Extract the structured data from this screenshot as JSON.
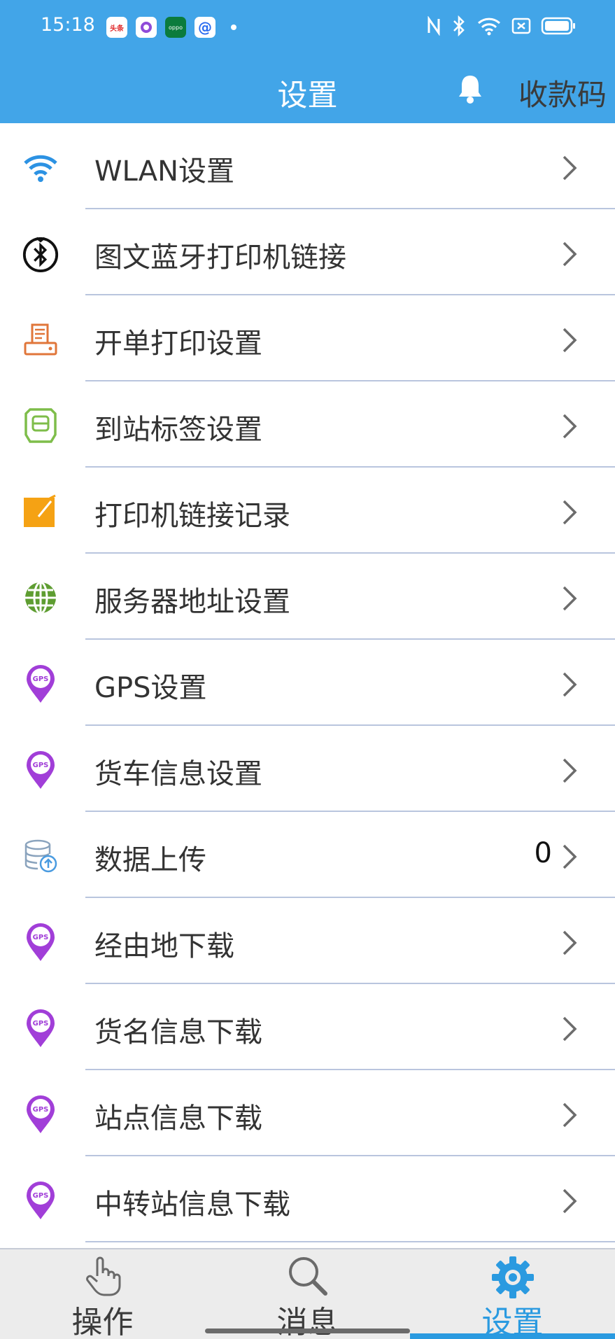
{
  "status_bar": {
    "time": "15:18",
    "notification_icons": [
      "toutiao-app-icon",
      "circle-app-icon",
      "oppo-app-icon",
      "at-app-icon"
    ],
    "toutiao_label": "头条",
    "oppo_label": "oppo",
    "at_label": "@",
    "system_icons": [
      "nfc-icon",
      "bluetooth-icon",
      "wifi-icon",
      "sim-icon",
      "battery-icon"
    ]
  },
  "header": {
    "title": "设置",
    "bell_icon": "bell-icon",
    "pay_code": "收款码",
    "background_color": "#42a5e8"
  },
  "settings": {
    "items": [
      {
        "icon": "wifi-icon",
        "label": "WLAN设置",
        "value": ""
      },
      {
        "icon": "bluetooth-icon",
        "label": "图文蓝牙打印机链接",
        "value": ""
      },
      {
        "icon": "printer-icon",
        "label": "开单打印设置",
        "value": ""
      },
      {
        "icon": "label-icon",
        "label": "到站标签设置",
        "value": ""
      },
      {
        "icon": "note-icon",
        "label": "打印机链接记录",
        "value": ""
      },
      {
        "icon": "globe-icon",
        "label": "服务器地址设置",
        "value": ""
      },
      {
        "icon": "gps-pin-icon",
        "label": "GPS设置",
        "value": ""
      },
      {
        "icon": "gps-pin-icon",
        "label": "货车信息设置",
        "value": ""
      },
      {
        "icon": "database-upload-icon",
        "label": "数据上传",
        "value": "0"
      },
      {
        "icon": "gps-pin-icon",
        "label": "经由地下载",
        "value": ""
      },
      {
        "icon": "gps-pin-icon",
        "label": "货名信息下载",
        "value": ""
      },
      {
        "icon": "gps-pin-icon",
        "label": "站点信息下载",
        "value": ""
      },
      {
        "icon": "gps-pin-icon",
        "label": "中转站信息下载",
        "value": ""
      }
    ],
    "gps_badge": "GPS"
  },
  "bottom_nav": {
    "items": [
      {
        "icon": "hand-pointer-icon",
        "label": "操作",
        "active": false
      },
      {
        "icon": "search-icon",
        "label": "消息",
        "active": false
      },
      {
        "icon": "gear-icon",
        "label": "设置",
        "active": true
      }
    ],
    "active_color": "#2a9ae0"
  }
}
